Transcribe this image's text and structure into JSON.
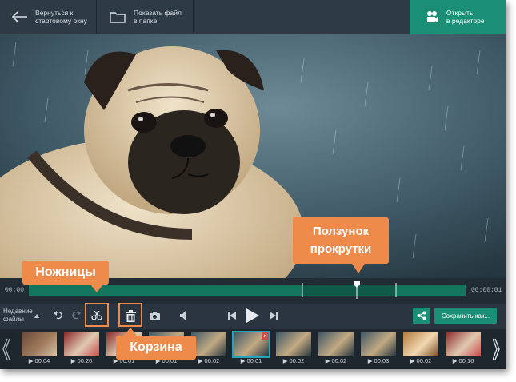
{
  "topbar": {
    "back_label": "Вернуться к\nстартовому окну",
    "show_file_label": "Показать файл\nв папке",
    "open_editor_label": "Открыть\nв редакторе"
  },
  "timeline": {
    "start_time": "00:00",
    "end_time": "00:00:01",
    "playhead_fraction": 0.75
  },
  "toolbar": {
    "recent_files_label": "Недавние\nфайлы",
    "save_as_label": "Сохранить как..."
  },
  "thumbnails": [
    {
      "duration": "▶ 00:04",
      "scene": "room"
    },
    {
      "duration": "▶ 00:20",
      "scene": "food"
    },
    {
      "duration": "▶ 00:01",
      "scene": "food"
    },
    {
      "duration": "▶ 00:01",
      "scene": "pug"
    },
    {
      "duration": "▶ 00:02",
      "scene": "pug"
    },
    {
      "duration": "▶ 00:01",
      "scene": "pug",
      "selected": true
    },
    {
      "duration": "▶ 00:02",
      "scene": "pug"
    },
    {
      "duration": "▶ 00:02",
      "scene": "pug"
    },
    {
      "duration": "▶ 00:03",
      "scene": "pug"
    },
    {
      "duration": "▶ 00:02",
      "scene": "cake"
    },
    {
      "duration": "▶ 00:16",
      "scene": "food"
    }
  ],
  "callouts": {
    "scissors": "Ножницы",
    "trash": "Корзина",
    "slider": "Ползунок\nпрокрутки"
  },
  "colors": {
    "accent": "#1a8f76",
    "callout": "#ee8a4a",
    "timeline_fill": "#14755f"
  }
}
